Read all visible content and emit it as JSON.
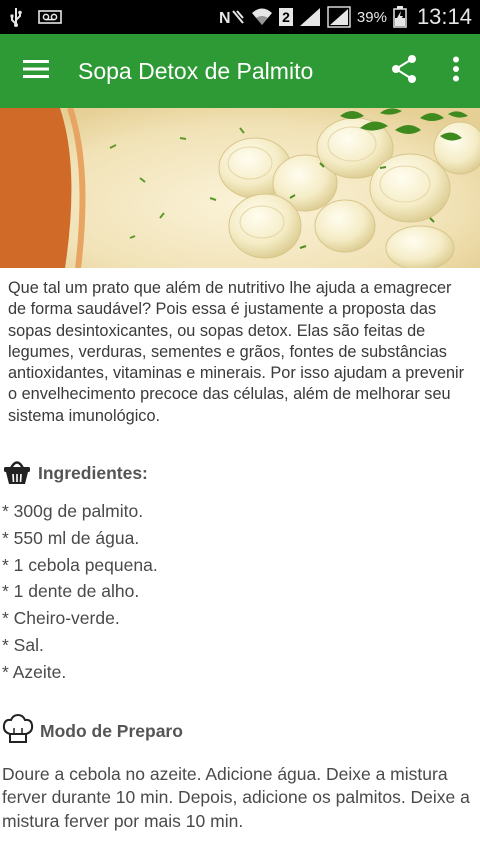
{
  "status_bar": {
    "battery_percent": "39%",
    "time": "13:14",
    "sim_number": "2"
  },
  "app_bar": {
    "title": "Sopa Detox de Palmito",
    "icons": [
      "menu-icon",
      "share-icon",
      "more-vert-icon"
    ],
    "color": "#2e9a36"
  },
  "article": {
    "intro": "Que tal um prato que além de nutritivo lhe ajuda a emagrecer de forma saudável? Pois essa é justamente a proposta das sopas desintoxicantes, ou sopas detox. Elas são feitas de legumes, verduras, sementes e grãos, fontes de substâncias antioxidantes, vitaminas e minerais. Por isso ajudam a prevenir o envelhecimento precoce das células, além de melhorar seu sistema imunológico.",
    "ingredients_title": "Ingredientes:",
    "ingredients": [
      "* 300g de palmito.",
      "* 550 ml de água.",
      "* 1 cebola pequena.",
      "* 1 dente de alho.",
      "* Cheiro-verde.",
      "* Sal.",
      "* Azeite."
    ],
    "preparation_title": "Modo de Preparo",
    "preparation": "Doure a cebola no azeite. Adicione água. Deixe a mistura ferver durante 10 min. Depois, adicione os palmitos. Deixe a mistura ferver por mais 10 min."
  }
}
